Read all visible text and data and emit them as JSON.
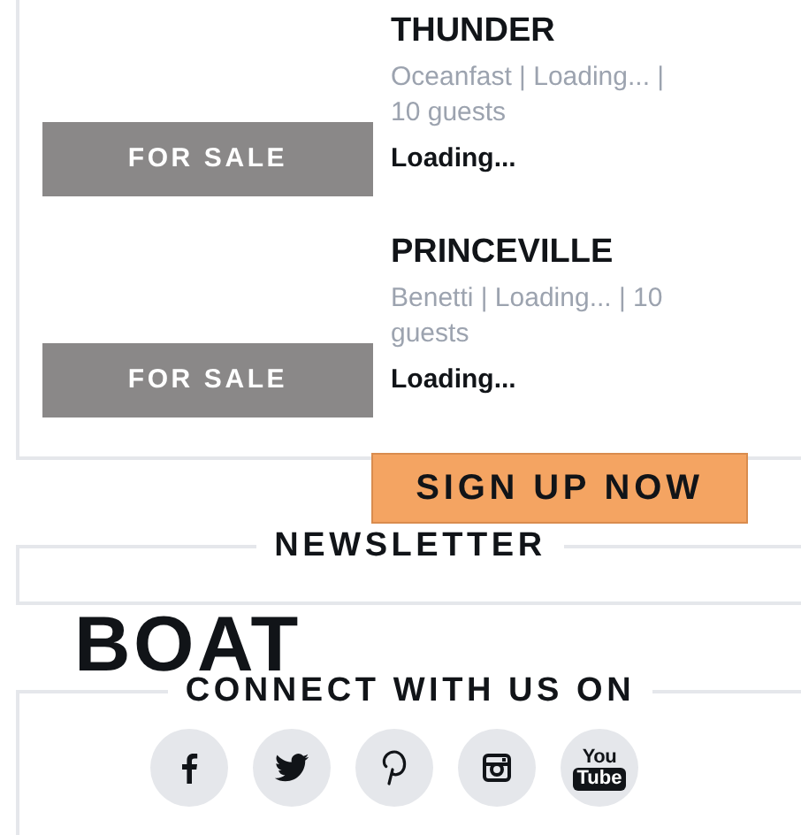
{
  "listings": [
    {
      "badge": "FOR SALE",
      "title": "THUNDER",
      "meta": "Oceanfast | Loading... | 10 guests",
      "price": "Loading..."
    },
    {
      "badge": "FOR SALE",
      "title": "PRINCEVILLE",
      "meta": "Benetti | Loading... | 10 guests",
      "price": "Loading..."
    }
  ],
  "signup_button": "SIGN UP NOW",
  "newsletter": {
    "heading": "NEWSLETTER"
  },
  "logo": "BOAT",
  "social": {
    "heading": "CONNECT WITH US ON",
    "links": [
      {
        "kind": "facebook"
      },
      {
        "kind": "twitter"
      },
      {
        "kind": "pinterest"
      },
      {
        "kind": "instagram"
      },
      {
        "kind": "youtube",
        "label_top": "You",
        "label_bottom": "Tube"
      }
    ]
  }
}
